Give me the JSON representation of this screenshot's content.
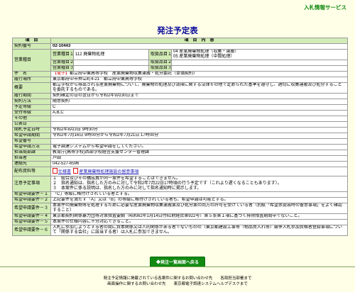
{
  "header": {
    "site_name": "入札情報サービス",
    "page_title": "発注予定表"
  },
  "table_header": {
    "item": "項　目",
    "content": "項　目　内　容"
  },
  "rows": {
    "contract_no": {
      "label": "契約番号",
      "value": "02-10443"
    },
    "business_type": {
      "label": "営業種目",
      "types": [
        {
          "label": "営業種目１",
          "value": "112 廃棄物処理"
        },
        {
          "label": "営業種目２",
          "value": ""
        },
        {
          "label": "営業種目３",
          "value": ""
        }
      ],
      "items": [
        {
          "label": "取扱品目１",
          "value": "04 産業廃棄物処理（収集・運搬）\n05 産業廃棄物処理（中間処理）"
        },
        {
          "label": "取扱品目２",
          "value": ""
        },
        {
          "label": "取扱品目３",
          "value": ""
        }
      ]
    },
    "subject": {
      "label": "件　名",
      "tag": "【電子】",
      "value": "都立府中東高等学校　産業廃棄物収集運搬・処分委託（単価契約）"
    },
    "place": {
      "label": "履行場所",
      "value": "東京都府中市押立町4-21　都立府中東高等学校"
    },
    "summary": {
      "label": "概要",
      "value": "都立学校から排出される産業廃棄物について、廃棄物の処理及び清掃に関する法律その他で定められた基準を遵守し、適切に収集運搬及び処分することを委託するものである。"
    },
    "period": {
      "label": "履行期間",
      "value": "契約確定の日の翌日から令和2年9月30日まで"
    },
    "contract_method": {
      "label": "契約方法",
      "value": "随意契約"
    },
    "prequal_grade": {
      "label": "予定等級",
      "value": "C"
    },
    "accept_grade": {
      "label": "受付等級",
      "value": "A,B,C"
    },
    "other": {
      "label": "その他",
      "value": ""
    },
    "publish_date": {
      "label": "公表日",
      "value": ""
    },
    "open_date": {
      "label": "開札予定日時",
      "value": "令和2年8月3日 9時30分"
    },
    "apply_period": {
      "label": "希望申請期間",
      "value": "令和2年7月16日 9時00分から令和2年7月21日 17時00分"
    },
    "apply_count": {
      "label": "希望番号",
      "value": ""
    },
    "apply_method": {
      "label": "希望申請方法",
      "value": "電子調達システムから希望申請をしてください。"
    },
    "department": {
      "label": "担当局部課",
      "value": "教育庁(高等学校)西部学校経営支援センター管理課"
    },
    "person": {
      "label": "担当者",
      "value": "戸田"
    },
    "contact": {
      "label": "連絡先",
      "value": "042-527-6596"
    },
    "attachments": {
      "label": "配布資料等",
      "files": [
        "仕様書",
        "産業廃棄物処理施設の留意事項"
      ]
    },
    "notes": {
      "label": "注意予定事項",
      "lines": [
        "１　組合及びその構成員が同一案件を希望することはできません。",
        "２　指名通知は、指名した方のみに対して令和2年7月22日17時頃の行う予定です（これより遅くなることもあります）。",
        "３　本案件に係る説明は、指名した方のみに対して指名通知時に掲示します。"
      ]
    },
    "req1": {
      "label": "希望申請要件－１",
      "value": "「C」等級に格付けされている者とする。"
    },
    "req2": {
      "label": "希望申請要件－２",
      "value": "上記要件を満たす「A」又は「B」の等級に格付けされている者も、希望申請は可能とする。"
    },
    "req3": {
      "label": "希望申請要件－３",
      "value": "本案件の廃棄物等を処理するために必要な産業廃棄物収集運搬業及び処分業の両方の許可を受けている者（別紙「希望票提出時の留意事項」をよく確認すること）"
    },
    "req4": {
      "label": "希望申請要件－４",
      "value": "東京都契約関係暴力団等対策措置要綱（昭和62年1月14日付61財経庶第922号）第５条第１項に基づく排除措置期間中でないこと。"
    },
    "req5": {
      "label": "希望申請要件－５",
      "value": "本案件の仕様内容に十分対応できること。"
    },
    "req6": {
      "label": "希望申請要件－６",
      "value": "入札に参加しようとする者の間に資本関係又は人的関係がある者でないものの（東京都建設工事等（物品買入れ等）競争入札参加資格者登録事項について「関係する会社」に該当する者）は入札に参加できません。"
    }
  },
  "back_button": {
    "label": "◆発注一覧画面へ戻る"
  },
  "footer": {
    "line1": "発注予定情報に掲載されている各案件に関するお問い合わせ先　　各局担当部署まで",
    "line2": "画面操作に関するお問い合わせ先　　東京都電子調達システムヘルプデスクまで"
  }
}
